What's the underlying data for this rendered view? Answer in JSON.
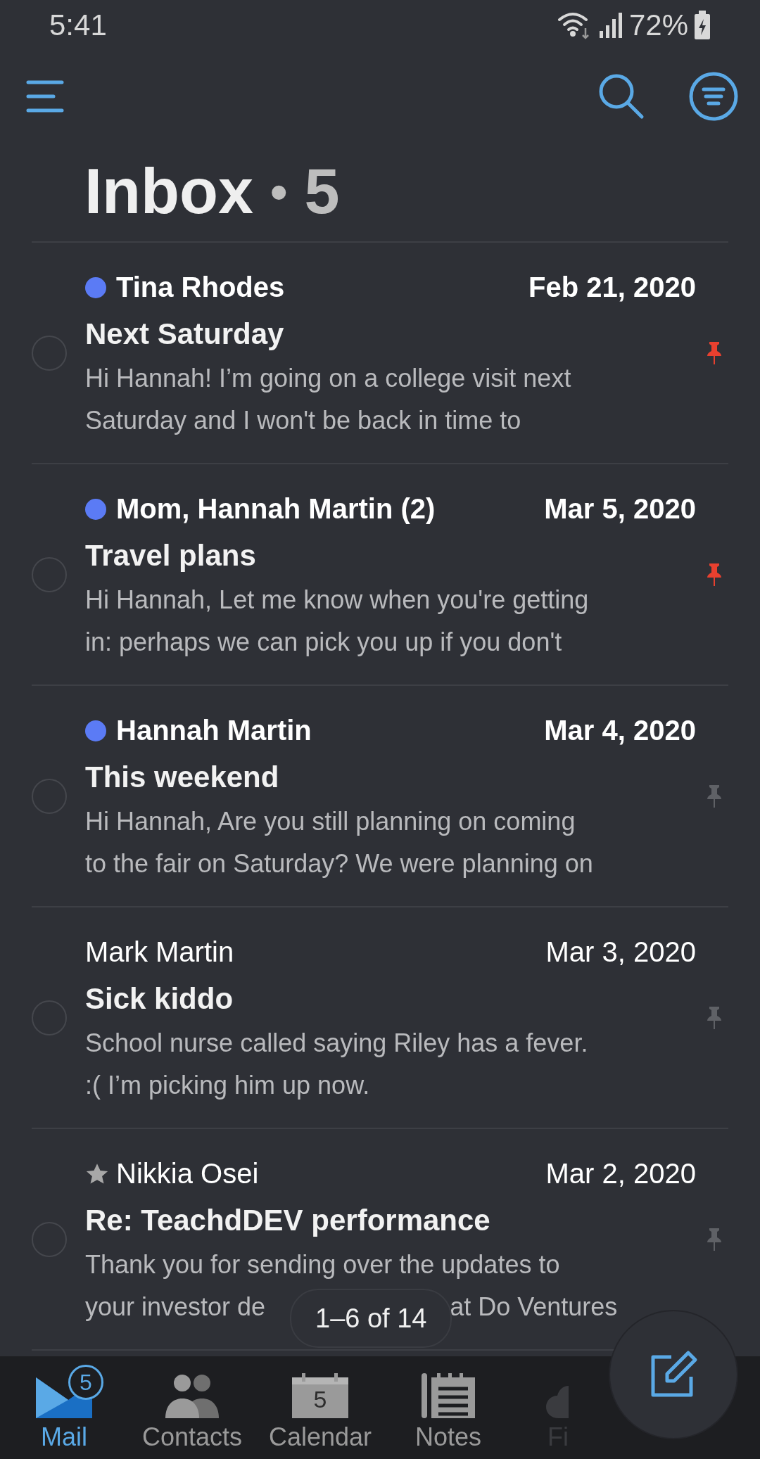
{
  "status_bar": {
    "time": "5:41",
    "battery": "72%"
  },
  "header": {
    "title": "Inbox",
    "separator": "•",
    "count": "5"
  },
  "messages": [
    {
      "sender": "Tina Rhodes",
      "unread": true,
      "starred": false,
      "date": "Feb 21, 2020",
      "subject": "Next Saturday",
      "preview": [
        [
          "Hi Hannah! I’m going on a college visit next"
        ],
        [
          "Saturday and I won't be back in time to"
        ]
      ],
      "pinned": true
    },
    {
      "sender": "Mom, Hannah Martin (2)",
      "unread": true,
      "starred": false,
      "date": "Mar 5, 2020",
      "subject": "Travel plans",
      "preview": [
        [
          "Hi Hannah, Let me know when you're getting"
        ],
        [
          "in: perhaps we can pick you up if you don't"
        ]
      ],
      "pinned": true
    },
    {
      "sender": "Hannah Martin",
      "unread": true,
      "starred": false,
      "date": "Mar 4, 2020",
      "subject": "This weekend",
      "preview": [
        [
          "Hi Hannah, Are you still planning on coming"
        ],
        [
          "to the fair on Saturday? We were planning on"
        ]
      ],
      "pinned": false
    },
    {
      "sender": "Mark Martin",
      "unread": false,
      "starred": false,
      "date": "Mar 3, 2020",
      "subject": "Sick kiddo",
      "preview": [
        [
          "School nurse called saying Riley has a fever."
        ],
        [
          ":( I’m picking him up now."
        ]
      ],
      "pinned": false
    },
    {
      "sender": "Nikkia Osei",
      "unread": false,
      "starred": true,
      "date": "Mar 2, 2020",
      "subject": "Re: TeachdDEV performance",
      "preview": [
        [
          "Thank you for sending over the updates to"
        ],
        [
          "your investor de",
          "at Do Ventures"
        ]
      ],
      "pinned": false
    }
  ],
  "pager": "1–6 of 14",
  "nav": [
    {
      "kind": "mail",
      "label": "Mail",
      "selected": true,
      "badge": "5"
    },
    {
      "kind": "contacts",
      "label": "Contacts",
      "selected": false
    },
    {
      "kind": "calendar",
      "label": "Calendar",
      "selected": false,
      "icon_text": "5"
    },
    {
      "kind": "notes",
      "label": "Notes",
      "selected": false
    },
    {
      "kind": "files",
      "label": "Fi",
      "selected": false
    }
  ]
}
